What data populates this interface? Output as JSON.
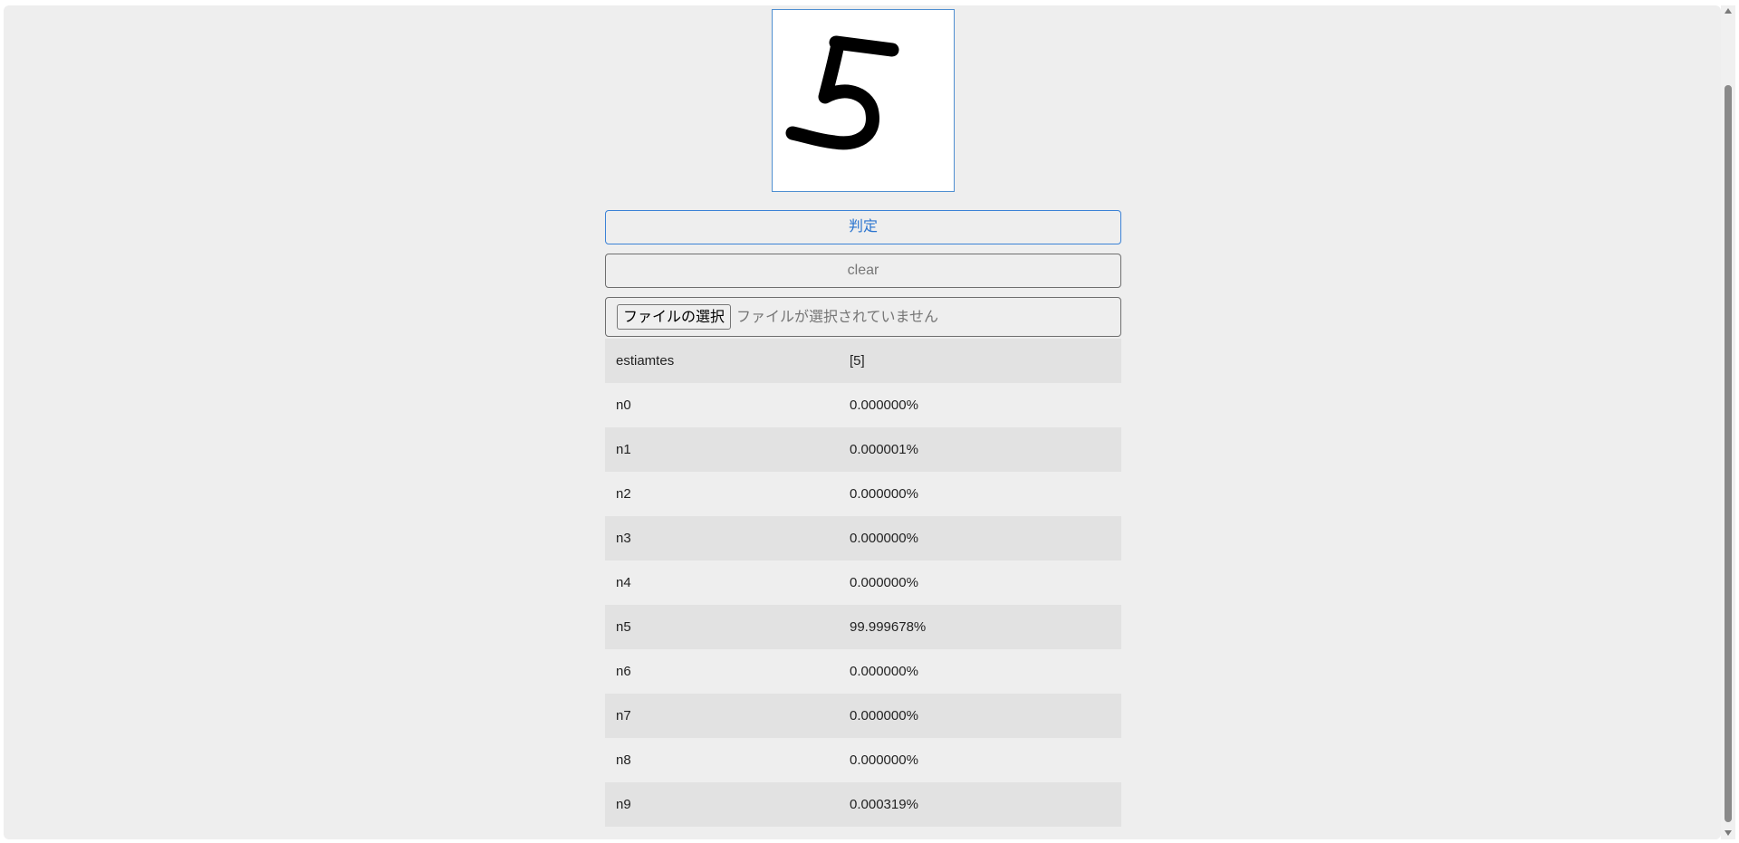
{
  "buttons": {
    "judge_label": "判定",
    "clear_label": "clear"
  },
  "file_input": {
    "button_label": "ファイルの選択",
    "status": "ファイルが選択されていません"
  },
  "results": {
    "estimate": {
      "label": "estiamtes",
      "value": "[5]"
    },
    "rows": [
      {
        "label": "n0",
        "value": "0.000000%"
      },
      {
        "label": "n1",
        "value": "0.000001%"
      },
      {
        "label": "n2",
        "value": "0.000000%"
      },
      {
        "label": "n3",
        "value": "0.000000%"
      },
      {
        "label": "n4",
        "value": "0.000000%"
      },
      {
        "label": "n5",
        "value": "99.999678%"
      },
      {
        "label": "n6",
        "value": "0.000000%"
      },
      {
        "label": "n7",
        "value": "0.000000%"
      },
      {
        "label": "n8",
        "value": "0.000000%"
      },
      {
        "label": "n9",
        "value": "0.000319%"
      }
    ]
  },
  "colors": {
    "accent": "#3b82d6",
    "background": "#eeeeee",
    "row_shade": "#e2e2e2",
    "ink": "#000000"
  }
}
